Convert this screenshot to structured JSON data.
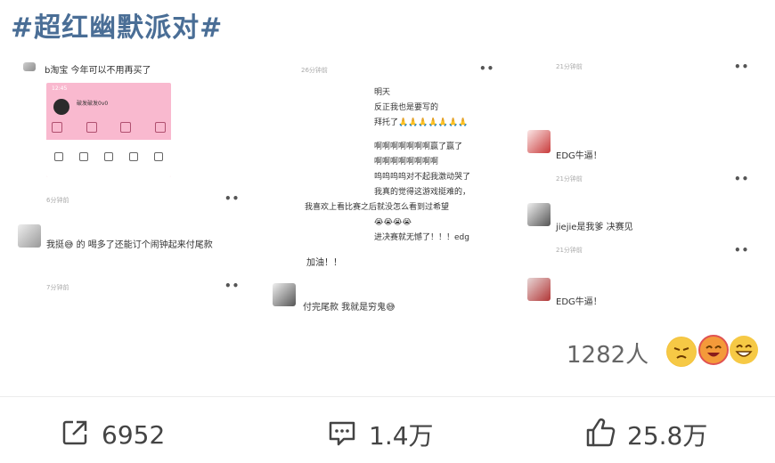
{
  "hashtag": "#超红幽默派对#",
  "posts": {
    "p1": {
      "text": "b淘宝 今年可以不用再买了",
      "time": "6分钟前",
      "phone": {
        "clock": "12:45",
        "username": "破发破发0v0"
      },
      "reply": {
        "text": "我挺😅 的  喝多了还能订个闹钟起来付尾款",
        "time": "7分钟前"
      }
    },
    "p2": {
      "time": "26分钟前",
      "chat_lines": [
        "明天",
        "反正我也是要写的",
        "拜托了🙏🙏🙏🙏🙏🙏🙏",
        "啊啊啊啊啊啊啊赢了赢了",
        "啊啊啊啊啊啊啊啊",
        "呜呜呜呜对不起我激动哭了",
        "我真的觉得这游戏挺难的，",
        "我喜欢上看比赛之后就没怎么看到过希望",
        "😭😭😭😭",
        "进决赛就无憾了！！！edg"
      ],
      "tail": "加油！！",
      "reply": "付完尾款 我就是穷鬼😅"
    },
    "p3": {
      "time1": "21分钟前",
      "c1": "EDG牛逼！",
      "time2": "21分钟前",
      "c2": "jiejie是我爹 决赛见",
      "time3": "21分钟前",
      "c3": "EDG牛逼！"
    }
  },
  "reactions": {
    "count": "1282人"
  },
  "actions": {
    "share": {
      "icon": "share-icon",
      "count": "6952"
    },
    "comment": {
      "icon": "comment-icon",
      "count": "1.4万"
    },
    "like": {
      "icon": "thumbs-up-icon",
      "count": "25.8万"
    }
  },
  "colors": {
    "hashtag": "#4a6e96",
    "phone_bg": "#f9b9cf"
  }
}
